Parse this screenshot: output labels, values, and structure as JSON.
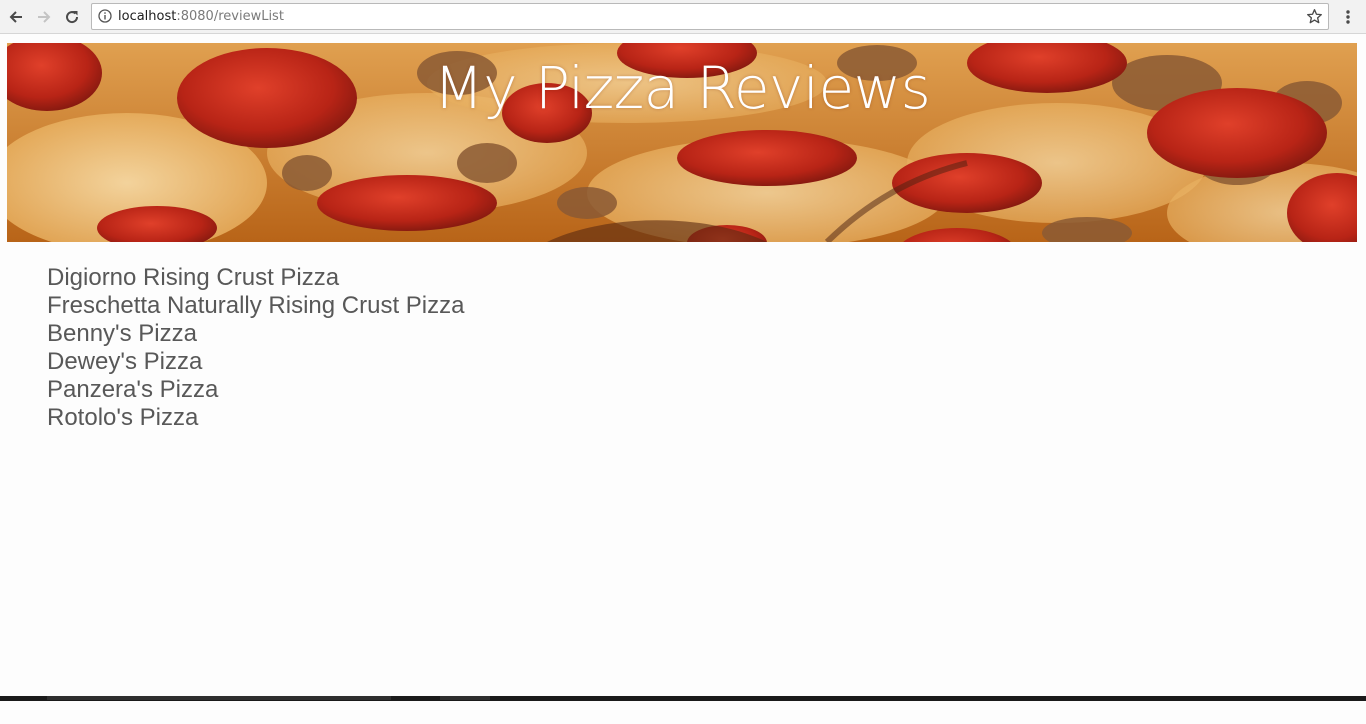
{
  "browser": {
    "url_host": "localhost",
    "url_path": ":8080/reviewList"
  },
  "header": {
    "title": "My Pizza Reviews"
  },
  "reviews": [
    "Digiorno Rising Crust Pizza",
    "Freschetta Naturally Rising Crust Pizza",
    "Benny's Pizza",
    "Dewey's Pizza",
    "Panzera's Pizza",
    "Rotolo's Pizza"
  ],
  "icons": {
    "back": "back-arrow-icon",
    "forward": "forward-arrow-icon",
    "reload": "reload-icon",
    "info": "info-icon",
    "bookmark": "star-icon",
    "menu": "kebab-menu-icon"
  },
  "colors": {
    "list_text": "#585858",
    "banner_title": "#ffffff",
    "page_background": "#fdfdfd"
  }
}
